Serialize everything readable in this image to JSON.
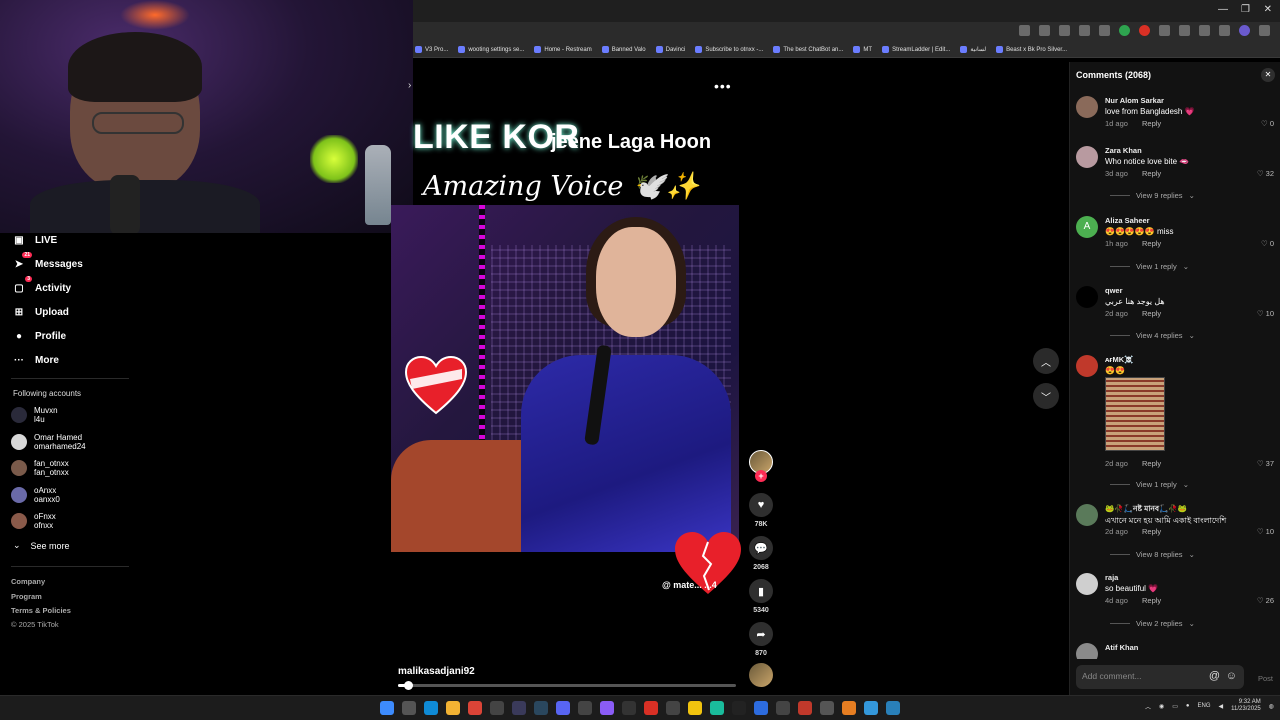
{
  "browser": {
    "bookmarks": [
      "V3 Pro...",
      "wooting settings se...",
      "Home - Restream",
      "Banned Valo",
      "Davinci",
      "Subscribe to otnxx -...",
      "The best ChatBot an...",
      "MT",
      "StreamLadder | Edit...",
      "لسانية",
      "Beast x Bk Pro Silver..."
    ]
  },
  "sidebar": {
    "nav": [
      {
        "label": "LIVE",
        "icon": "live-icon"
      },
      {
        "label": "Messages",
        "icon": "messages-icon",
        "badge": "21"
      },
      {
        "label": "Activity",
        "icon": "activity-icon",
        "badge": "3"
      },
      {
        "label": "Upload",
        "icon": "upload-icon"
      },
      {
        "label": "Profile",
        "icon": "profile-icon"
      },
      {
        "label": "More",
        "icon": "more-icon"
      }
    ],
    "following_title": "Following accounts",
    "accounts": [
      {
        "name": "Muvxn",
        "handle": "l4u"
      },
      {
        "name": "Omar Hamed",
        "handle": "omarhamed24"
      },
      {
        "name": "fan_otnxx",
        "handle": "fan_otnxx"
      },
      {
        "name": "oAnxx",
        "handle": "oanxx0"
      },
      {
        "name": "oFnxx",
        "handle": "ofnxx"
      }
    ],
    "see_more": "See more",
    "footer": {
      "company": "Company",
      "program": "Program",
      "terms": "Terms & Policies",
      "copyright": "© 2025 TikTok"
    }
  },
  "video": {
    "caption_line1": "LIKE KOR",
    "caption_line1b": "jeene Laga Hoon",
    "caption_line2": "Amazing Voice 🕊️✨",
    "watermark": "@ mate... ...4",
    "username": "malikasadjani92",
    "progress": 0.03,
    "more_label": "•••"
  },
  "actions": {
    "likes": "78K",
    "comments": "2068",
    "saves": "5340",
    "shares": "870"
  },
  "comments": {
    "header": "Comments (2068)",
    "input_placeholder": "Add comment...",
    "post_label": "Post",
    "reply_label": "Reply",
    "items": [
      {
        "user": "Nur Alom Sarkar",
        "text": "love from Bangladesh 💗",
        "time": "1d ago",
        "likes": "0",
        "avatar_color": "#8a6a5a"
      },
      {
        "user": "Zara Khan",
        "text": "Who notice love bite 🫦",
        "time": "3d ago",
        "likes": "32",
        "avatar_color": "#b89aa0",
        "view_replies": "View 9 replies"
      },
      {
        "user": "Aliza Saheer",
        "text": "😍😍😍😍😍 miss",
        "time": "1h ago",
        "likes": "0",
        "avatar_color": "#4caf50",
        "avatar_letter": "A",
        "view_replies": "View 1 reply"
      },
      {
        "user": "qwer",
        "text": "هل يوجد هنا عربي",
        "time": "2d ago",
        "likes": "10",
        "avatar_color": "#000000",
        "view_replies": "View 4 replies"
      },
      {
        "user": "ᴀғMK☠️",
        "text": "😍😍",
        "time": "2d ago",
        "likes": "37",
        "avatar_color": "#c0392b",
        "view_replies": "View 1 reply"
      },
      {
        "user": "🐸🥀🛴নষ্ট মানব🛴🥀🐸",
        "text": "এখানে মনে হয় আমি একাই বাংলাদেশি",
        "time": "2d ago",
        "likes": "10",
        "avatar_color": "#5a7a5a",
        "view_replies": "View 8 replies"
      },
      {
        "user": "raja",
        "text": "so beautiful 💗",
        "time": "4d ago",
        "likes": "26",
        "avatar_color": "#cfcfcf",
        "view_replies": "View 2 replies"
      },
      {
        "user": "Atif Khan",
        "text": "",
        "time": "",
        "likes": "",
        "avatar_color": "#8a8a8a"
      }
    ]
  },
  "taskbar": {
    "lang": "ENG",
    "time": "9:32 AM",
    "date": "11/23/2025"
  },
  "colors": {
    "accent": "#fe2c55",
    "panel": "#121212"
  }
}
